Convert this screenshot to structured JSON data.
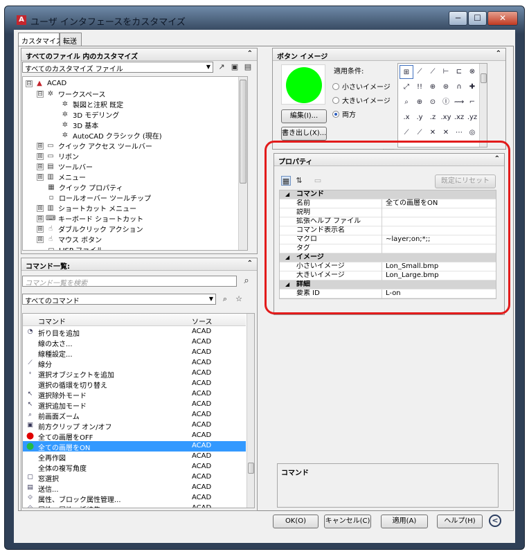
{
  "window": {
    "title": "ユーザ インタフェースをカスタマイズ",
    "min": "─",
    "max": "☐",
    "close": "✕"
  },
  "tabs": [
    {
      "label": "カスタマイズ"
    },
    {
      "label": "転送"
    }
  ],
  "customize_panel": {
    "title": "すべてのファイル 内のカスタマイズ",
    "file_select": "すべてのカスタマイズ ファイル",
    "tree": [
      {
        "label": "ACAD",
        "exp": "⊟"
      },
      {
        "label": "ワークスペース",
        "exp": "⊟"
      },
      {
        "label": "製図と注釈 既定"
      },
      {
        "label": "3D モデリング"
      },
      {
        "label": "3D 基本"
      },
      {
        "label": "AutoCAD クラシック (現在)"
      },
      {
        "label": "クイック アクセス ツールバー",
        "exp": "⊞"
      },
      {
        "label": "リボン",
        "exp": "⊞"
      },
      {
        "label": "ツールバー",
        "exp": "⊞"
      },
      {
        "label": "メニュー",
        "exp": "⊞"
      },
      {
        "label": "クイック プロパティ"
      },
      {
        "label": "ロールオーバー ツールチップ"
      },
      {
        "label": "ショートカット メニュー",
        "exp": "⊞"
      },
      {
        "label": "キーボード ショートカット",
        "exp": "⊞"
      },
      {
        "label": "ダブルクリック アクション",
        "exp": "⊞"
      },
      {
        "label": "マウス ボタン",
        "exp": "⊞"
      },
      {
        "label": "LISP ファイル"
      }
    ]
  },
  "command_panel": {
    "title": "コマンド一覧:",
    "search_placeholder": "コマンド一覧を検索",
    "filter": "すべてのコマンド",
    "col_command": "コマンド",
    "col_source": "ソース",
    "rows": [
      {
        "name": "折り目を追加",
        "source": "ACAD",
        "icon": "◔"
      },
      {
        "name": "線の太さ...",
        "source": "ACAD",
        "icon": ""
      },
      {
        "name": "線種設定...",
        "source": "ACAD",
        "icon": ""
      },
      {
        "name": "線分",
        "source": "ACAD",
        "icon": "⟋"
      },
      {
        "name": "選択オブジェクトを追加",
        "source": "ACAD",
        "icon": "⬫"
      },
      {
        "name": "選択の循環を切り替え",
        "source": "ACAD",
        "icon": ""
      },
      {
        "name": "選択除外モード",
        "source": "ACAD",
        "icon": "↖"
      },
      {
        "name": "選択追加モード",
        "source": "ACAD",
        "icon": "↖"
      },
      {
        "name": "前画面ズーム",
        "source": "ACAD",
        "icon": "⌕"
      },
      {
        "name": "前方クリップ オン/オフ",
        "source": "ACAD",
        "icon": "▣"
      },
      {
        "name": "全ての画層をOFF",
        "source": "ACAD",
        "icon": "●"
      },
      {
        "name": "全ての画層をON",
        "source": "ACAD",
        "icon": "●"
      },
      {
        "name": "全再作図",
        "source": "ACAD",
        "icon": ""
      },
      {
        "name": "全体の複写角度",
        "source": "ACAD",
        "icon": ""
      },
      {
        "name": "窓選択",
        "source": "ACAD",
        "icon": "▢"
      },
      {
        "name": "送信...",
        "source": "ACAD",
        "icon": "▤"
      },
      {
        "name": "属性、ブロック属性管理...",
        "source": "ACAD",
        "icon": "⟐"
      },
      {
        "name": "属性、属性一括編集...",
        "source": "ACAD",
        "icon": "⟐"
      }
    ],
    "selected_index": 11
  },
  "button_image_panel": {
    "title": "ボタン イメージ",
    "apply_label": "適用条件:",
    "options": [
      "小さいイメージ",
      "大きいイメージ",
      "両方"
    ],
    "edit_button": "編集(I)...",
    "export_button": "書き出し(X)...",
    "preview_color": "#00ff00",
    "icons": [
      "⊞",
      "⟋",
      "⟋",
      "⊢",
      "⊏",
      "⊗",
      "⤢",
      "!!",
      "⊕",
      "⊛",
      "∩",
      "✚",
      "⌕",
      "⊕",
      "⊙",
      "Ⓘ",
      "⟿",
      "⌐",
      ".x",
      ".y",
      ".z",
      ".xy",
      ".xz",
      ".yz",
      "⟋",
      "⟋",
      "✕",
      "✕",
      "⋯",
      "◎"
    ]
  },
  "properties_panel": {
    "title": "プロパティ",
    "reset_button": "既定にリセット",
    "groups": [
      {
        "category": "コマンド",
        "rows": [
          {
            "key": "名前",
            "value": "全ての画層をON"
          },
          {
            "key": "説明",
            "value": ""
          },
          {
            "key": "拡張ヘルプ ファイル",
            "value": ""
          },
          {
            "key": "コマンド表示名",
            "value": ""
          },
          {
            "key": "マクロ",
            "value": "~layer;on;*;;"
          },
          {
            "key": "タグ",
            "value": ""
          }
        ]
      },
      {
        "category": "イメージ",
        "rows": [
          {
            "key": "小さいイメージ",
            "value": "Lon_Small.bmp"
          },
          {
            "key": "大きいイメージ",
            "value": "Lon_Large.bmp"
          }
        ]
      },
      {
        "category": "詳細",
        "rows": [
          {
            "key": "要素 ID",
            "value": "L-on"
          }
        ]
      }
    ]
  },
  "description_panel": {
    "title": "コマンド"
  },
  "footer": {
    "ok": "OK(O)",
    "cancel": "キャンセル(C)",
    "apply": "適用(A)",
    "help": "ヘルプ(H)"
  },
  "colors": {
    "highlight": "#e21b1b",
    "selection": "#3399ff",
    "layer_off": "#e00000",
    "layer_on": "#22bb44"
  }
}
